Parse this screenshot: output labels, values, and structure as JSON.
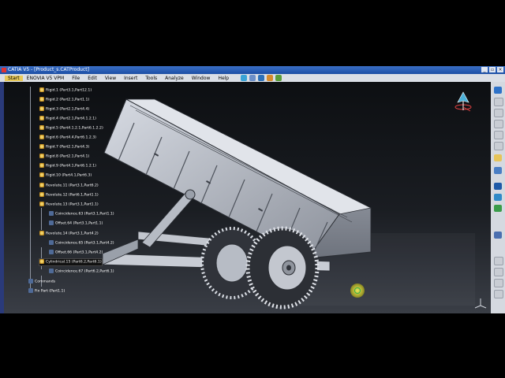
{
  "window": {
    "title": "CATIA V5 - [Product_s.CATProduct]"
  },
  "menu": [
    "Start",
    "ENOVIA V5 VPM",
    "File",
    "Edit",
    "View",
    "Insert",
    "Tools",
    "Analyze",
    "Window",
    "Help"
  ],
  "tree": [
    "Rigid.1 (Part3.1,Part12.1)",
    "Rigid.2 (Part2.1,Part1.1)",
    "Rigid.3 (Part2.1,Part4.4)",
    "Rigid.4 (Part2.1,Part4.1.2.1)",
    "Rigid.5 (Part4.1.2.1,Part6.1.2.2)",
    "Rigid.6 (Part4.4,Part6.1.2.3)",
    "Rigid.7 (Part2.1,Part4.3)",
    "Rigid.8 (Part2.1,Part4.1)",
    "Rigid.9 (Part4.1,Part6.1.2.1)",
    "Rigid.10 (Part4.1,Part6.3)",
    "Revolute.11 (Part3.1,Part6.2)",
    "Revolute.12 (Part6.1,Part1.1)",
    "Revolute.13 (Part3.1,Part1.1)",
    "Coincidence.63 (Part3.1,Part1.1)",
    "Offset.64 (Part3.1,Part1.1)",
    "Revolute.14 (Part3.1,Part4.2)",
    "Coincidence.65 (Part3.1,Part4.2)",
    "Offset.66 (Part3.1,Part4.2)",
    "Cylindrical.15 (Part6.2,Part6.1)",
    "Coincidence.67 (Part6.2,Part6.1)",
    "Commands",
    "Fix Part (Part1.1)"
  ],
  "colors": {
    "menubar": "#dbdfe6",
    "titlebar": "#2b5bb5",
    "model": "#c8ccd4"
  },
  "icons": [
    "compass-icon",
    "axis-icon",
    "spinner-icon"
  ]
}
